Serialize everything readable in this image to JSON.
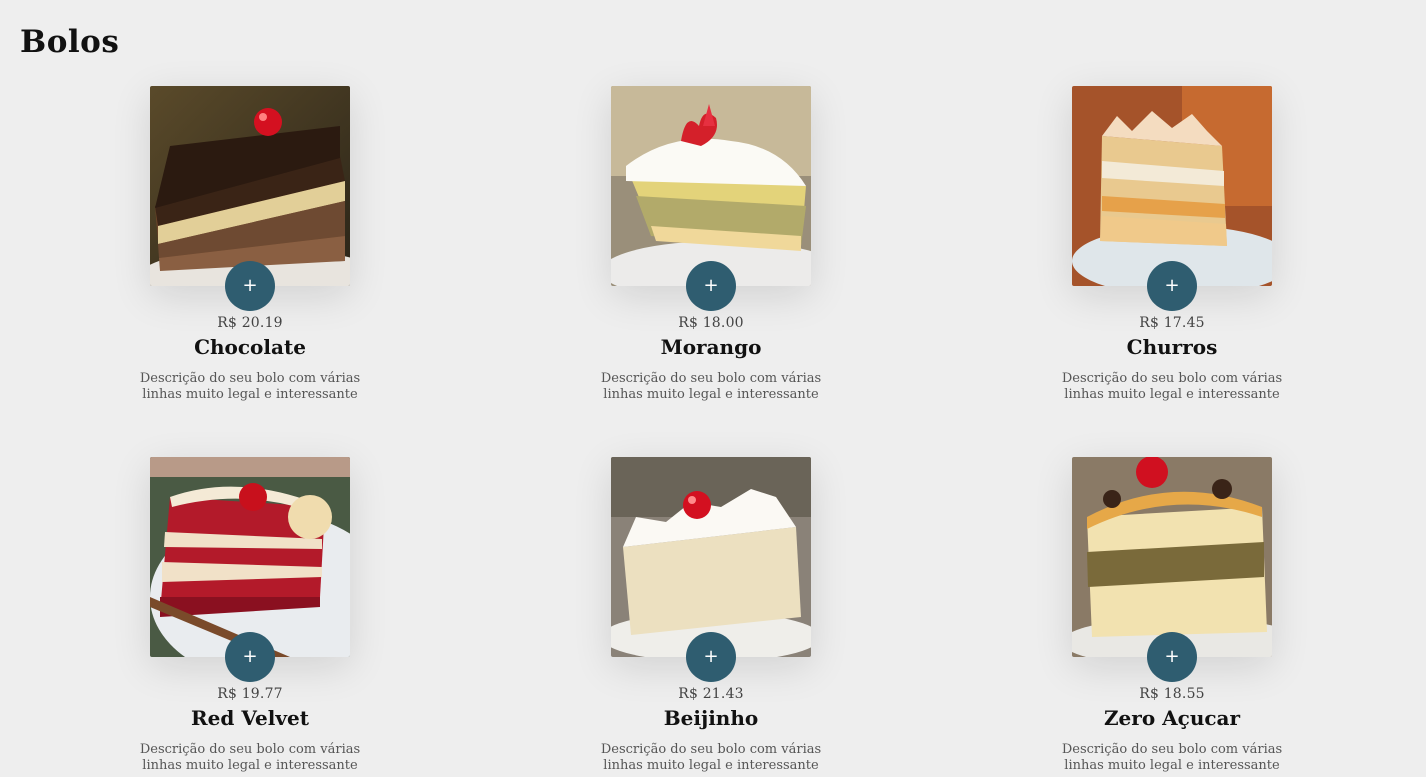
{
  "section": {
    "title": "Bolos"
  },
  "colors": {
    "background": "#eeeeee",
    "button": "#2f5d70",
    "button_text": "#ffffff"
  },
  "products": [
    {
      "name": "Chocolate",
      "price": "R$ 20.19",
      "description": "Descrição do seu bolo com várias linhas muito legal e interessante",
      "button_label": "+",
      "image_icon": "chocolate-cake-slice-image"
    },
    {
      "name": "Morango",
      "price": "R$ 18.00",
      "description": "Descrição do seu bolo com várias linhas muito legal e interessante",
      "button_label": "+",
      "image_icon": "strawberry-cake-slice-image"
    },
    {
      "name": "Churros",
      "price": "R$ 17.45",
      "description": "Descrição do seu bolo com várias linhas muito legal e interessante",
      "button_label": "+",
      "image_icon": "churros-cake-slice-image"
    },
    {
      "name": "Red Velvet",
      "price": "R$ 19.77",
      "description": "Descrição do seu bolo com várias linhas muito legal e interessante",
      "button_label": "+",
      "image_icon": "red-velvet-cake-slice-image"
    },
    {
      "name": "Beijinho",
      "price": "R$ 21.43",
      "description": "Descrição do seu bolo com várias linhas muito legal e interessante",
      "button_label": "+",
      "image_icon": "beijinho-cake-slice-image"
    },
    {
      "name": "Zero Açucar",
      "price": "R$ 18.55",
      "description": "Descrição do seu bolo com várias linhas muito legal e interessante",
      "button_label": "+",
      "image_icon": "sugar-free-cake-slice-image"
    }
  ]
}
